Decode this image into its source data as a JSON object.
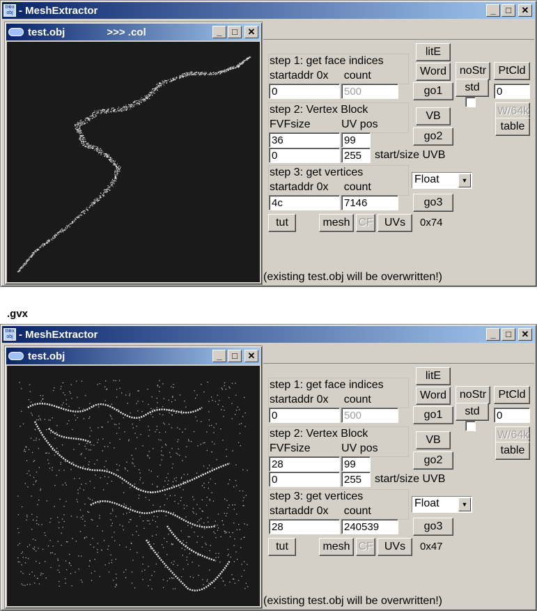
{
  "app_title": "MeshExtractor",
  "app_title_prefix": "- MeshExtractor",
  "app_icon_text": "II⊗x obj",
  "separator_label": ".gvx",
  "windows": [
    {
      "child_title": "test.obj",
      "child_extra": ">>> .col",
      "step1": {
        "title": "step 1: get face indices",
        "sub": "startaddr 0x     count",
        "startaddr": "0",
        "count": "500"
      },
      "step2": {
        "title": "step 2: Vertex Block",
        "sub": "FVFsize          UV pos",
        "fvfsize": "36",
        "uvpos": "99",
        "uvb_start": "0",
        "uvb_size": "255",
        "uvb_label": "start/size UVB"
      },
      "step3": {
        "title": "step 3: get vertices",
        "sub": "startaddr 0x     count",
        "startaddr": "4c",
        "count": "7146",
        "format": "Float"
      },
      "buttons": {
        "lite": "litE",
        "word": "Word",
        "nostr": "noStr",
        "std": "std",
        "ptcld": "PtCld",
        "go1": "go1",
        "vb": "VB",
        "go2": "go2",
        "go3": "go3",
        "w64k": "W/64k",
        "table": "table",
        "tut": "tut",
        "mesh": "mesh",
        "cf": "CF",
        "uvs": "UVs"
      },
      "ptcld_value": "0",
      "hex_readout": "0x74",
      "notice": "(existing test.obj will be overwritten!)",
      "preview": "serpentine mesh"
    },
    {
      "child_title": "test.obj",
      "child_extra": "",
      "step1": {
        "title": "step 1: get face indices",
        "sub": "startaddr 0x     count",
        "startaddr": "0",
        "count": "500"
      },
      "step2": {
        "title": "step 2: Vertex Block",
        "sub": "FVFsize          UV pos",
        "fvfsize": "28",
        "uvpos": "99",
        "uvb_start": "0",
        "uvb_size": "255",
        "uvb_label": "start/size UVB"
      },
      "step3": {
        "title": "step 3: get vertices",
        "sub": "startaddr 0x     count",
        "startaddr": "28",
        "count": "240539",
        "format": "Float"
      },
      "buttons": {
        "lite": "litE",
        "word": "Word",
        "nostr": "noStr",
        "std": "std",
        "ptcld": "PtCld",
        "go1": "go1",
        "vb": "VB",
        "go2": "go2",
        "go3": "go3",
        "w64k": "W/64k",
        "table": "table",
        "tut": "tut",
        "mesh": "mesh",
        "cf": "CF",
        "uvs": "UVs"
      },
      "ptcld_value": "0",
      "hex_readout": "0x47",
      "notice": "(existing test.obj will be overwritten!)",
      "preview": "point cloud terrain"
    }
  ],
  "colors": {
    "titlebar_start": "#0a246a",
    "titlebar_end": "#a6caf0",
    "face": "#d4d0c8",
    "canvas": "#1a1a1a"
  }
}
